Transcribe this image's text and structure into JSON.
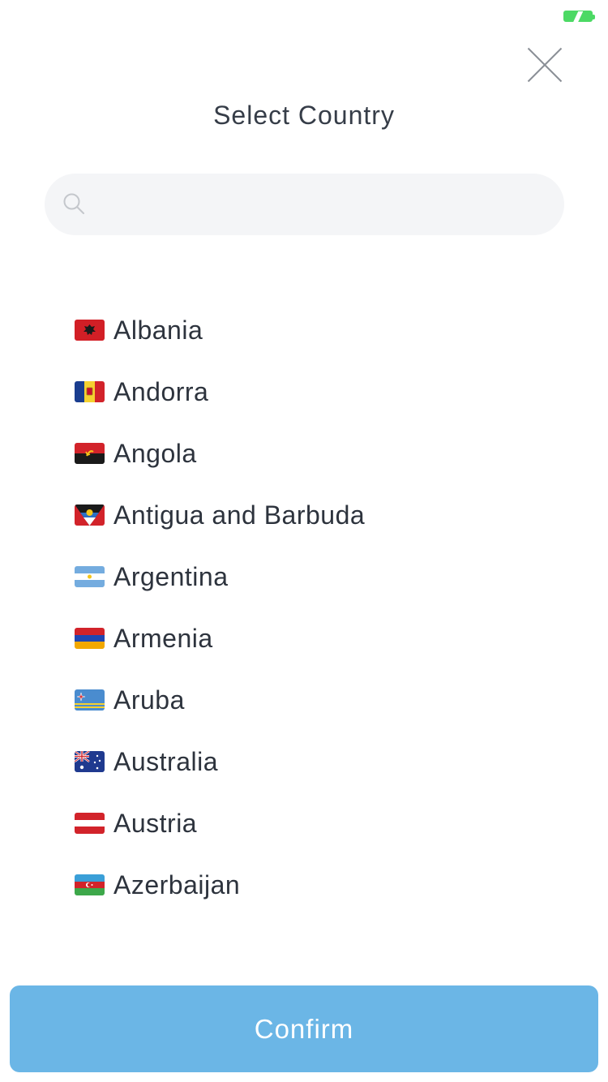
{
  "header": {
    "title": "Select Country",
    "close_icon": "close-icon"
  },
  "status": {
    "battery_icon": "battery-charging-icon",
    "battery_color": "#4cd964"
  },
  "search": {
    "placeholder": "",
    "value": "",
    "icon": "search-icon"
  },
  "countries": [
    {
      "name": "Albania",
      "flag": "albania-flag-icon"
    },
    {
      "name": "Andorra",
      "flag": "andorra-flag-icon"
    },
    {
      "name": "Angola",
      "flag": "angola-flag-icon"
    },
    {
      "name": "Antigua and Barbuda",
      "flag": "antigua-and-barbuda-flag-icon"
    },
    {
      "name": "Argentina",
      "flag": "argentina-flag-icon"
    },
    {
      "name": "Armenia",
      "flag": "armenia-flag-icon"
    },
    {
      "name": "Aruba",
      "flag": "aruba-flag-icon"
    },
    {
      "name": "Australia",
      "flag": "australia-flag-icon"
    },
    {
      "name": "Austria",
      "flag": "austria-flag-icon"
    },
    {
      "name": "Azerbaijan",
      "flag": "azerbaijan-flag-icon"
    }
  ],
  "footer": {
    "confirm_label": "Confirm",
    "confirm_color": "#6bb6e6"
  }
}
